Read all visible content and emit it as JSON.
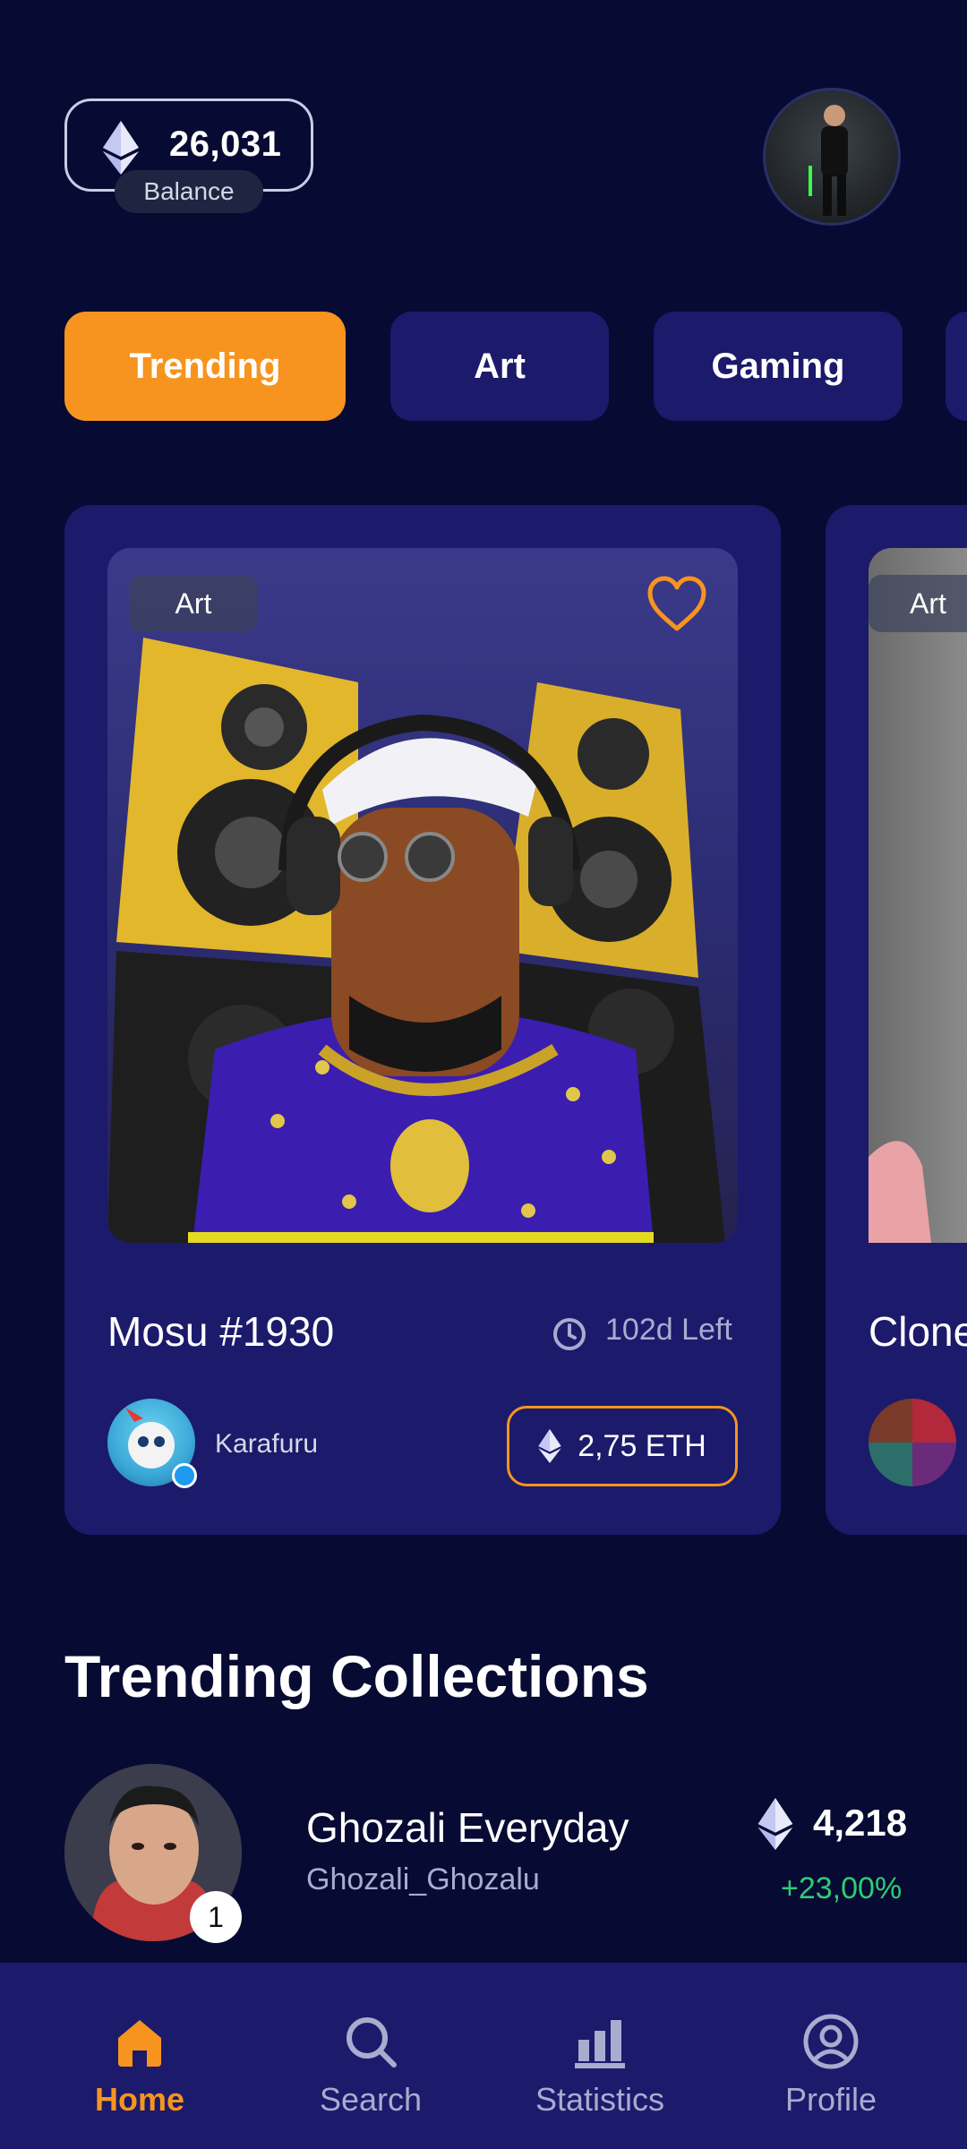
{
  "balance": {
    "value": "26,031",
    "label": "Balance",
    "icon": "ethereum-icon"
  },
  "profile": {
    "icon": "avatar"
  },
  "tabs": [
    {
      "label": "Trending",
      "active": true
    },
    {
      "label": "Art",
      "active": false
    },
    {
      "label": "Gaming",
      "active": false
    }
  ],
  "featured": [
    {
      "category": "Art",
      "title": "Mosu #1930",
      "time_left": "102d Left",
      "creator": "Karafuru",
      "price": "2,75 ETH"
    },
    {
      "category": "Art",
      "title": "Clone"
    }
  ],
  "trending_collections": {
    "title": "Trending Collections",
    "items": [
      {
        "rank": "1",
        "name": "Ghozali Everyday",
        "handle": "Ghozali_Ghozalu",
        "value": "4,218",
        "change": "+23,00%"
      }
    ]
  },
  "nav": [
    {
      "label": "Home",
      "icon": "home-icon",
      "active": true
    },
    {
      "label": "Search",
      "icon": "search-icon",
      "active": false
    },
    {
      "label": "Statistics",
      "icon": "statistics-icon",
      "active": false
    },
    {
      "label": "Profile",
      "icon": "profile-icon",
      "active": false
    }
  ],
  "colors": {
    "background": "#070A33",
    "surface": "#1C1A6B",
    "accent": "#F7941F",
    "positive": "#2ECC71"
  }
}
